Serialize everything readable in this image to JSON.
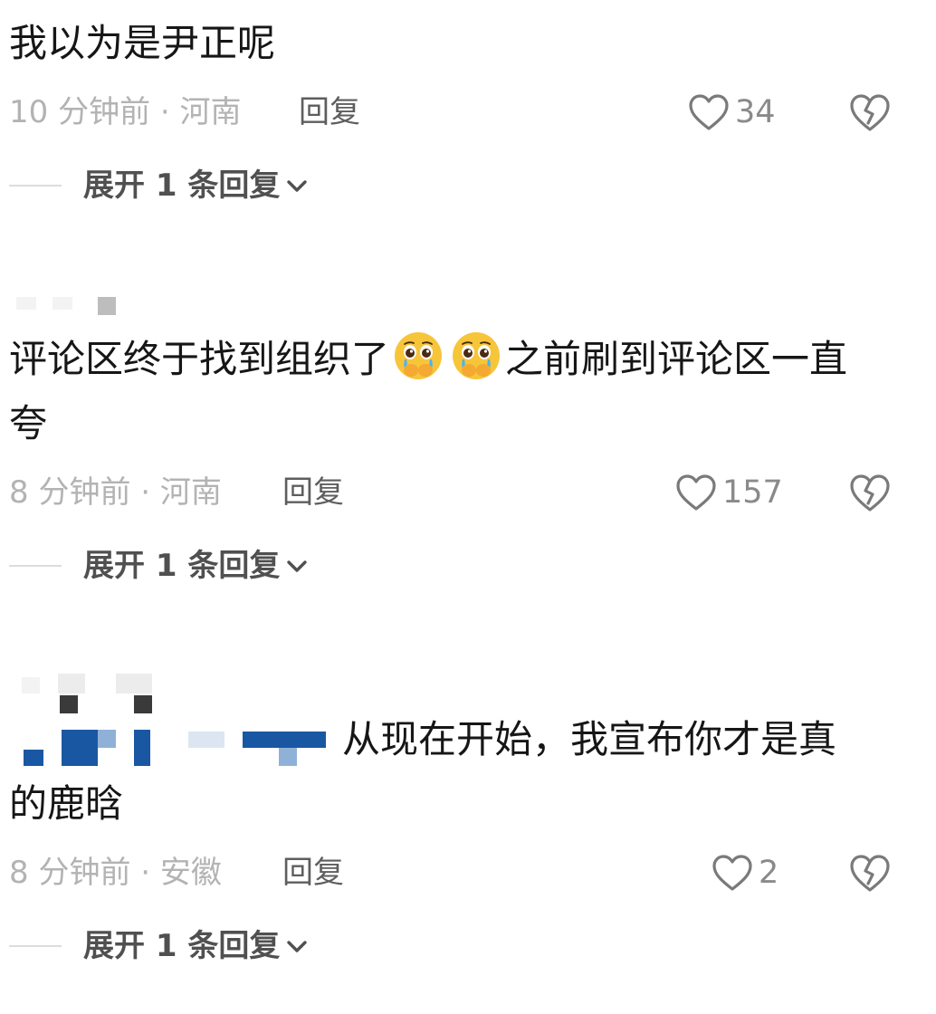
{
  "comments": [
    {
      "text": "我以为是尹正呢",
      "time_location": "10 分钟前 · 河南",
      "reply_label": "回复",
      "likes": "34",
      "expand_label": "展开 1 条回复"
    },
    {
      "text_line1_a": "评论区终于找到组织了",
      "text_line1_b": "之前刷到评论区一直",
      "text_line2": "夸",
      "emoji": "pleading-face-crying-emoji",
      "time_location": "8 分钟前 · 河南",
      "reply_label": "回复",
      "likes": "157",
      "expand_label": "展开 1 条回复"
    },
    {
      "text_line1": "从现在开始，我宣布你才是真",
      "text_line2": "的鹿晗",
      "time_location": "8 分钟前 · 安徽",
      "reply_label": "回复",
      "likes": "2",
      "expand_label": "展开 1 条回复"
    }
  ],
  "icons": {
    "like": "heart-outline-icon",
    "dislike": "broken-heart-icon",
    "expand": "chevron-down-icon"
  },
  "colors": {
    "text": "#161616",
    "meta": "#b3b3b3",
    "reply": "#5e5e5e",
    "icon": "#7a7a7a",
    "emoji": "#f7c53a"
  }
}
